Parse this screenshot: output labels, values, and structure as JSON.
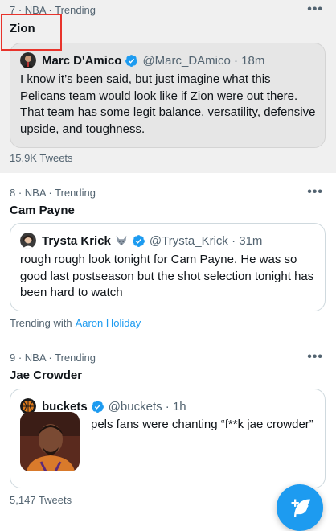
{
  "trends": [
    {
      "meta": "7 · NBA · Trending",
      "topic": "Zion",
      "more": "•••",
      "tweet": {
        "name": "Marc D'Amico",
        "handle_time": "@Marc_DAmico · 18m",
        "text": "I know it’s been said, but just imagine what this Pelicans team would look like if Zion were out there. That team has some legit balance, versatility, defensive upside, and toughness."
      },
      "count": "15.9K Tweets"
    },
    {
      "meta": "8 · NBA · Trending",
      "topic": "Cam Payne",
      "more": "•••",
      "tweet": {
        "name": "Trysta Krick",
        "handle_time": "@Trysta_Krick · 31m",
        "text": "rough rough look tonight for Cam Payne. He was so good last postseason but the shot selection tonight has been hard to watch"
      },
      "trending_with_label": "Trending with",
      "trending_with_link": "Aaron Holiday"
    },
    {
      "meta": "9 · NBA · Trending",
      "topic": "Jae Crowder",
      "more": "•••",
      "tweet": {
        "name": "buckets",
        "handle_time": "@buckets · 1h",
        "text": "pels fans were chanting “f**k jae crowder”"
      },
      "count": "5,147 Tweets"
    }
  ],
  "colors": {
    "accent": "#1d9bf0",
    "highlight": "#e8332b",
    "secondary_text": "#536471"
  },
  "icons": {
    "verified": "verified-badge-icon",
    "compose": "compose-tweet-icon",
    "more": "more-options-icon"
  }
}
